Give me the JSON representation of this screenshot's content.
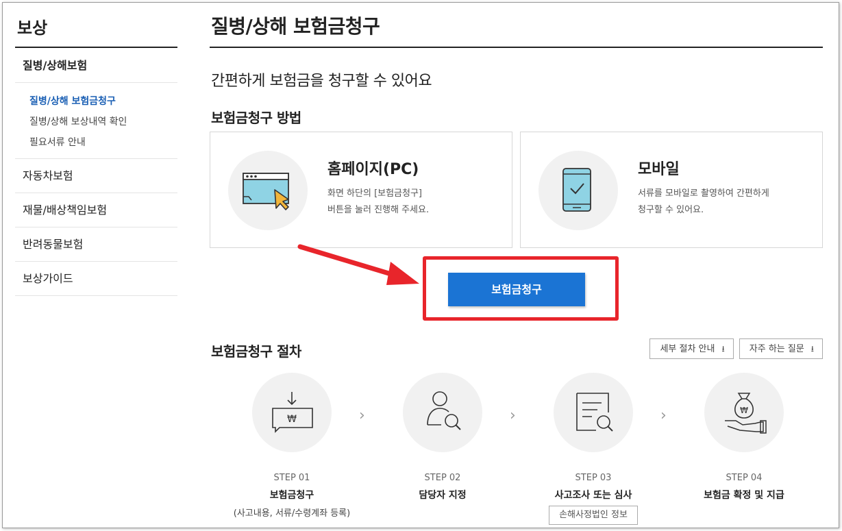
{
  "sidebar": {
    "title": "보상",
    "items": [
      {
        "label": "질병/상해보험"
      },
      {
        "label": "자동차보험"
      },
      {
        "label": "재물/배상책임보험"
      },
      {
        "label": "반려동물보험"
      },
      {
        "label": "보상가이드"
      }
    ],
    "subitems": [
      {
        "label": "질병/상해 보험금청구"
      },
      {
        "label": "질병/상해 보상내역 확인"
      },
      {
        "label": "필요서류 안내"
      }
    ]
  },
  "main": {
    "title": "질병/상해 보험금청구",
    "intro": "간편하게 보험금을 청구할 수 있어요",
    "method_title": "보험금청구 방법",
    "methods": [
      {
        "title": "홈페이지(PC)",
        "line1": "화면 하단의 [보험금청구]",
        "line2": "버튼을 눌러 진행해 주세요.",
        "icon": "browser-cursor-icon"
      },
      {
        "title": "모바일",
        "line1": "서류를 모바일로 촬영하여 간편하게",
        "line2": "청구할 수 있어요.",
        "icon": "phone-check-icon"
      }
    ],
    "claim_button": "보험금청구",
    "process_title": "보험금청구 절차",
    "process_buttons": [
      {
        "label": "세부 절차 안내",
        "icon": "download-icon"
      },
      {
        "label": "자주 하는 질문",
        "icon": "download-icon"
      }
    ],
    "steps": [
      {
        "label": "STEP 01",
        "name": "보험금청구",
        "sub": "(사고내용, 서류/수령계좌 등록)",
        "icon": "claim-won-icon"
      },
      {
        "label": "STEP 02",
        "name": "담당자 지정",
        "icon": "person-search-icon"
      },
      {
        "label": "STEP 03",
        "name": "사고조사 또는 심사",
        "sub_button": "손해사정법인 정보",
        "icon": "document-search-icon"
      },
      {
        "label": "STEP 04",
        "name": "보험금 확정 및 지급",
        "icon": "money-bag-hand-icon"
      }
    ]
  },
  "colors": {
    "accent": "#1b74d4",
    "highlight": "#e8252b",
    "active_link": "#1a5fb4"
  }
}
